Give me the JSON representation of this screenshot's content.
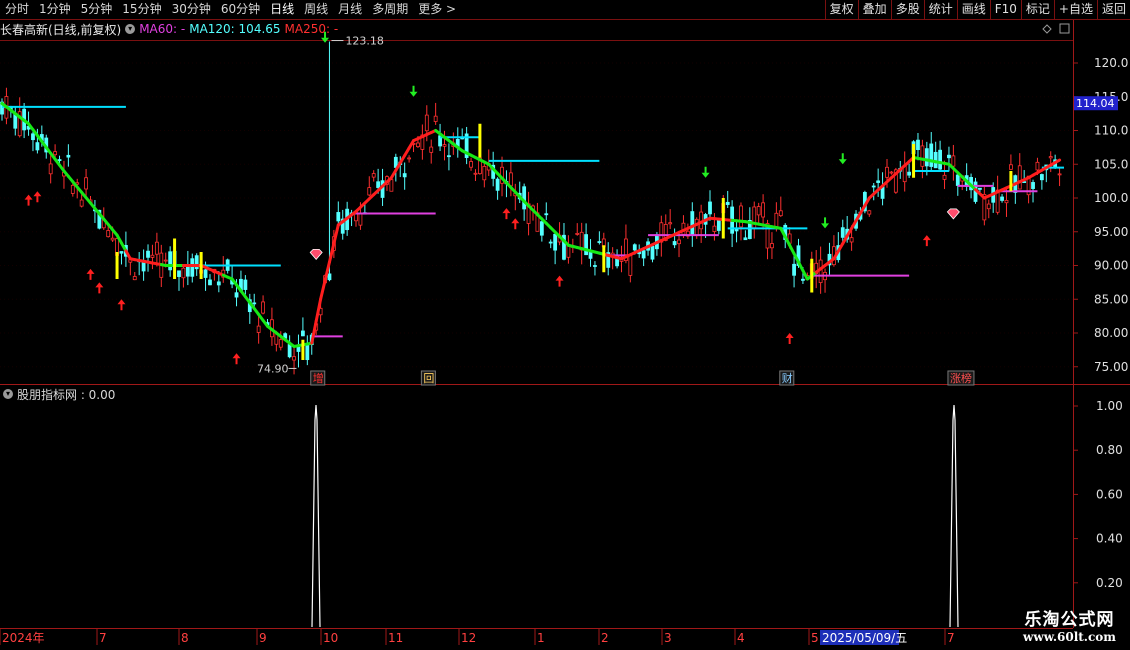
{
  "toolbar": {
    "periods": [
      "分时",
      "1分钟",
      "5分钟",
      "15分钟",
      "30分钟",
      "60分钟",
      "日线",
      "周线",
      "月线",
      "多周期",
      "更多"
    ],
    "active_period": "日线",
    "more_arrow": ">",
    "right_buttons": [
      "复权",
      "叠加",
      "多股",
      "统计",
      "画线",
      "F10",
      "标记",
      "+自选",
      "返回"
    ]
  },
  "legend": {
    "stock_title": "长春高新(日线,前复权)",
    "ma60": "MA60: -",
    "ma120": "MA120: 104.65",
    "ma250": "MA250: -"
  },
  "price_chart": {
    "y_ticks": [
      "120.0",
      "115.0",
      "110.0",
      "105.0",
      "100.0",
      "95.00",
      "90.00",
      "85.00",
      "80.00",
      "75.00"
    ],
    "current_price": "114.04",
    "high_label": "123.18",
    "low_label": "74.90",
    "event_badges": [
      "增",
      "回",
      "财",
      "涨榜"
    ]
  },
  "indicator": {
    "title": "股朋指标网 : 0.00",
    "y_ticks": [
      "1.00",
      "0.80",
      "0.60",
      "0.40",
      "0.20"
    ]
  },
  "x_axis": {
    "labels": [
      "2024年",
      "7",
      "8",
      "9",
      "10",
      "11",
      "12",
      "1",
      "2",
      "3",
      "4",
      "5",
      "7"
    ],
    "cursor_date": "2025/05/09/五"
  },
  "watermark": {
    "line1": "乐淘公式网",
    "line2": "www.60lt.com"
  },
  "colors": {
    "up": "#ff3030",
    "down": "#54ffff",
    "trend_up": "#ff1e1e",
    "trend_down": "#16e816",
    "resistance": "#00e0ff",
    "support": "#e040e0",
    "axis": "#a01818"
  }
}
